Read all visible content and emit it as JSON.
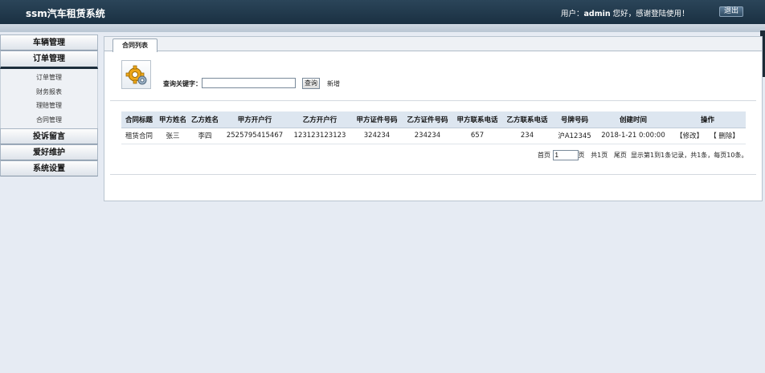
{
  "header": {
    "app_title": "ssm汽车租赁系统",
    "user_prefix": "用户：",
    "user_name": "admin",
    "welcome_suffix": " 您好，感谢登陆使用！",
    "logout_label": "退出"
  },
  "sidebar": {
    "menus": [
      {
        "label": "车辆管理"
      },
      {
        "label": "订单管理",
        "open": true,
        "items": [
          "订单管理",
          "财务报表",
          "理赔管理",
          "合同管理"
        ]
      },
      {
        "label": "投诉留言"
      },
      {
        "label": "爱好维护"
      },
      {
        "label": "系统设置"
      }
    ]
  },
  "tab": {
    "label": "合同列表"
  },
  "search": {
    "label": "查询关键字：",
    "value": "",
    "button_label": "查询",
    "add_label": "新增"
  },
  "table": {
    "columns": [
      "合同标题",
      "甲方姓名",
      "乙方姓名",
      "甲方开户行",
      "乙方开户行",
      "甲方证件号码",
      "乙方证件号码",
      "甲方联系电话",
      "乙方联系电话",
      "号牌号码",
      "创建时间",
      "操作"
    ],
    "rows": [
      {
        "title": "租赁合同",
        "party_a": "张三",
        "party_b": "李四",
        "bank_a": "2525795415467",
        "bank_b": "123123123123",
        "id_a": "324234",
        "id_b": "234234",
        "phone_a": "657",
        "phone_b": "234",
        "plate": "沪A12345",
        "created": "2018-1-21 0:00:00",
        "edit": "【修改】",
        "delete": "【 删除】"
      }
    ]
  },
  "pager": {
    "first": "首页",
    "page_value": "1",
    "page_suffix": "页",
    "total_pages": "共1页",
    "last": "尾页",
    "summary": "显示第1到1条记录，共1条，每页10条。"
  }
}
